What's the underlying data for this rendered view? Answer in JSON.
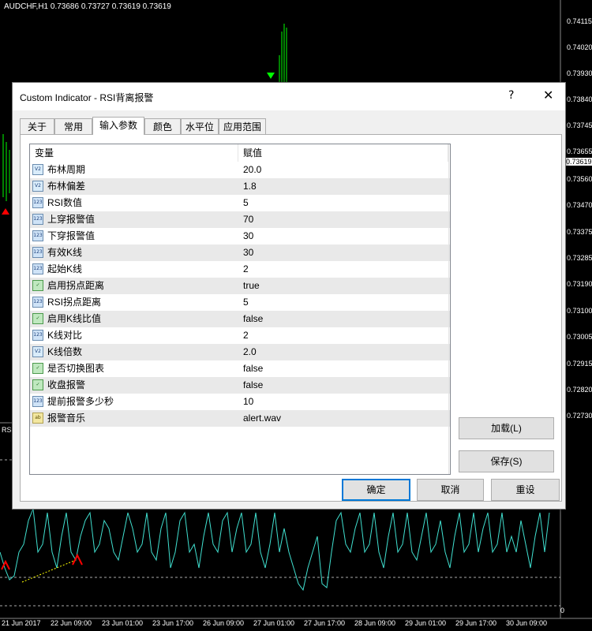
{
  "chart": {
    "title": "AUDCHF,H1  0.73686 0.73727 0.73619 0.73619",
    "current_price": "0.73619",
    "prices": [
      "0.74115",
      "0.74020",
      "0.73930",
      "0.73840",
      "0.73745",
      "0.73655",
      "0.73560",
      "0.73470",
      "0.73375",
      "0.73285",
      "0.73190",
      "0.73100",
      "0.73005",
      "0.72915",
      "0.72820",
      "0.72730"
    ],
    "rsi_label": "RS",
    "rsi_zero": "0",
    "times": [
      "21 Jun 2017",
      "22 Jun 09:00",
      "23 Jun 01:00",
      "23 Jun 17:00",
      "26 Jun 09:00",
      "27 Jun 01:00",
      "27 Jun 17:00",
      "28 Jun 09:00",
      "29 Jun 01:00",
      "29 Jun 17:00",
      "30 Jun 09:00"
    ],
    "colors": {
      "candle": "#00ff00",
      "rsi": "#40e0d0",
      "arrow_up": "#ff0000",
      "arrow_down": "#00ff00"
    }
  },
  "dialog": {
    "title": "Custom Indicator - RSI背离报警",
    "help": "?",
    "close": "✕",
    "tabs": [
      "关于",
      "常用",
      "输入参数",
      "颜色",
      "水平位",
      "应用范围"
    ],
    "active_tab": "输入参数",
    "grid": {
      "headers": [
        "变量",
        "赋值"
      ],
      "rows": [
        {
          "icon": "V2",
          "type": "dbl",
          "name": "布林周期",
          "value": "20.0"
        },
        {
          "icon": "V2",
          "type": "dbl",
          "name": "布林偏差",
          "value": "1.8"
        },
        {
          "icon": "123",
          "type": "int",
          "name": "RSI数值",
          "value": "5"
        },
        {
          "icon": "123",
          "type": "int",
          "name": "上穿报警值",
          "value": "70"
        },
        {
          "icon": "123",
          "type": "int",
          "name": "下穿报警值",
          "value": "30"
        },
        {
          "icon": "123",
          "type": "int",
          "name": "有效K线",
          "value": "30"
        },
        {
          "icon": "123",
          "type": "int",
          "name": "起始K线",
          "value": "2"
        },
        {
          "icon": "✓",
          "type": "bool",
          "name": "启用拐点距离",
          "value": "true"
        },
        {
          "icon": "123",
          "type": "int",
          "name": "RSI拐点距离",
          "value": "5"
        },
        {
          "icon": "✓",
          "type": "bool",
          "name": "启用K线比值",
          "value": "false"
        },
        {
          "icon": "123",
          "type": "int",
          "name": "K线对比",
          "value": "2"
        },
        {
          "icon": "V2",
          "type": "dbl",
          "name": "K线倍数",
          "value": "2.0"
        },
        {
          "icon": "✓",
          "type": "bool",
          "name": "是否切换图表",
          "value": "false"
        },
        {
          "icon": "✓",
          "type": "bool",
          "name": "收盘报警",
          "value": "false"
        },
        {
          "icon": "123",
          "type": "int",
          "name": "提前报警多少秒",
          "value": "10"
        },
        {
          "icon": "ab",
          "type": "str",
          "name": "报警音乐",
          "value": "alert.wav"
        }
      ]
    },
    "buttons": {
      "load": "加载(L)",
      "save": "保存(S)",
      "ok": "确定",
      "cancel": "取消",
      "reset": "重设"
    }
  }
}
